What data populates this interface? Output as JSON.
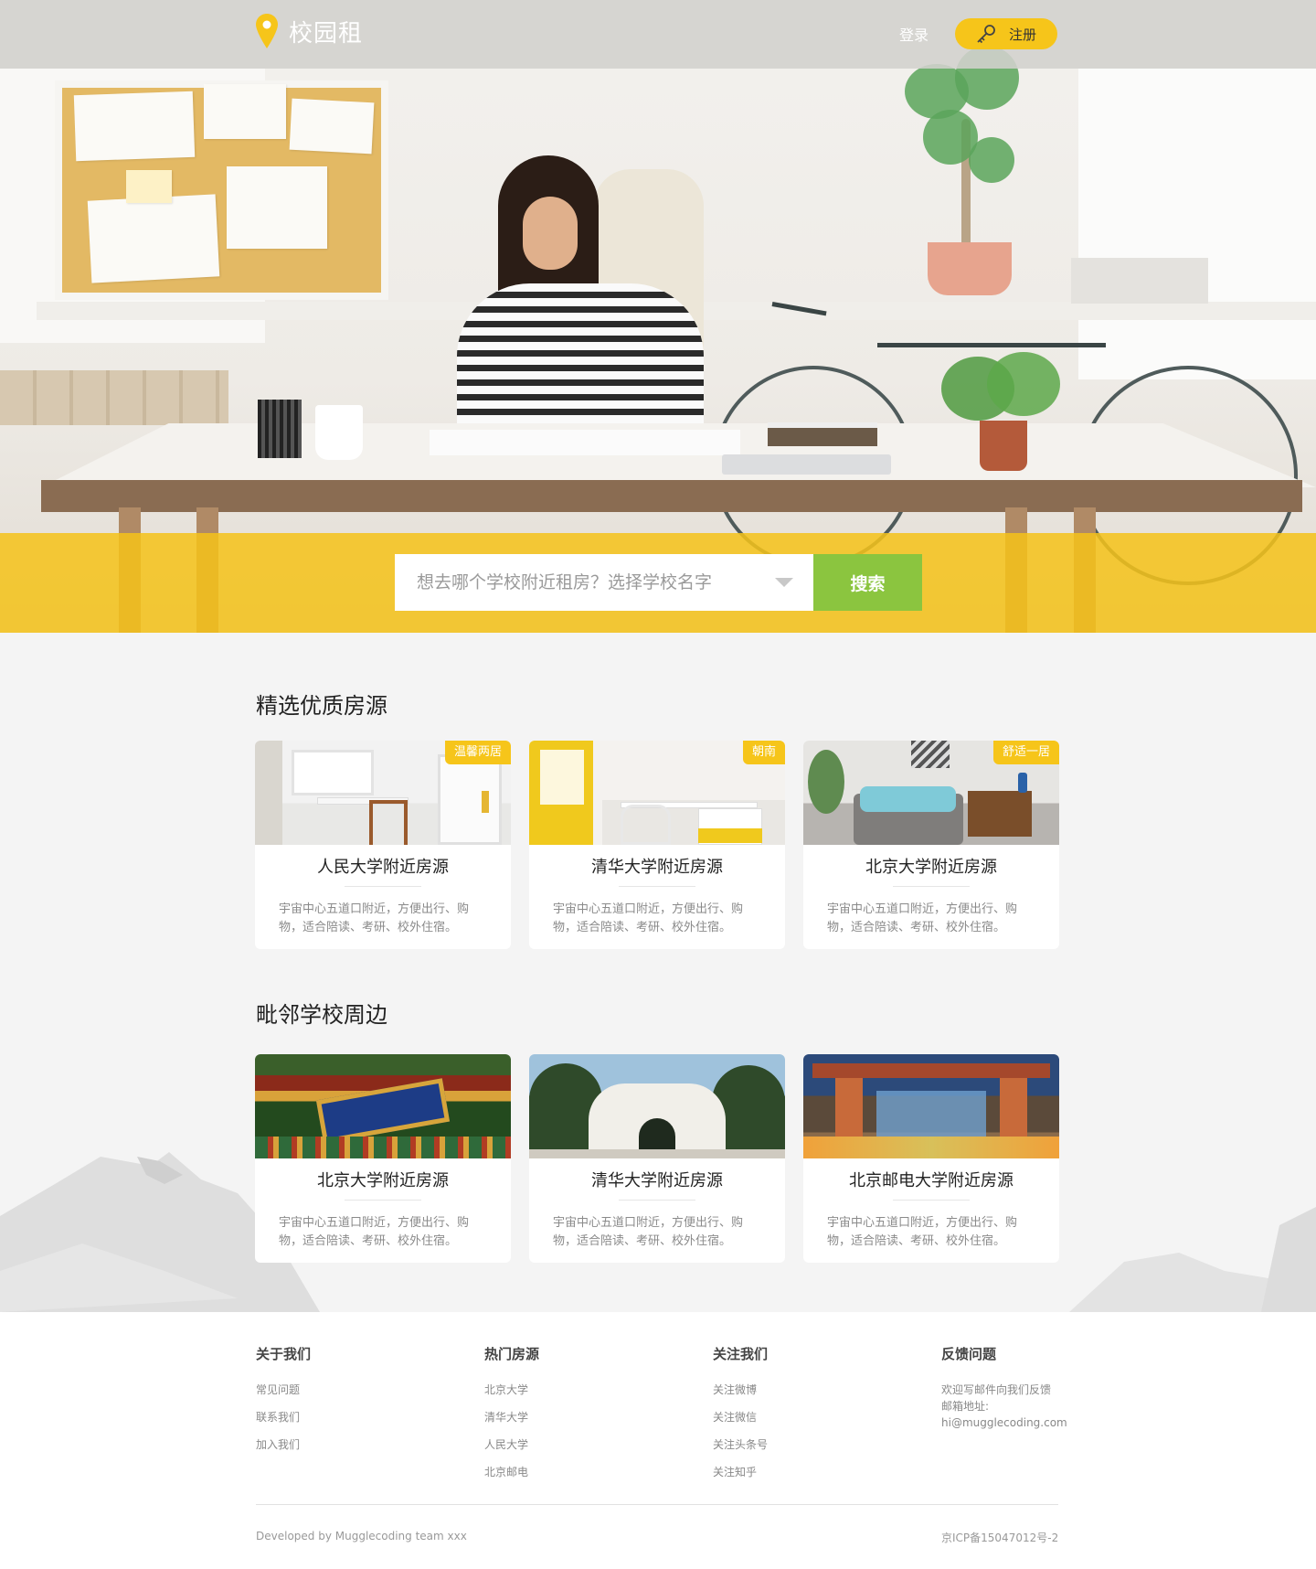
{
  "header": {
    "logo_text": "校园租",
    "login_label": "登录",
    "register_label": "注册"
  },
  "search": {
    "placeholder": "想去哪个学校附近租房？选择学校名字",
    "button_label": "搜索"
  },
  "colors": {
    "accent_yellow": "#f6c51a",
    "search_green": "#8bc53f"
  },
  "featured": {
    "title": "精选优质房源",
    "cards": [
      {
        "tag": "温馨两居",
        "title": "人民大学附近房源",
        "desc": "宇宙中心五道口附近，方便出行、购物，适合陪读、考研、校外住宿。"
      },
      {
        "tag": "朝南",
        "title": "清华大学附近房源",
        "desc": "宇宙中心五道口附近，方便出行、购物，适合陪读、考研、校外住宿。"
      },
      {
        "tag": "舒适一居",
        "title": "北京大学附近房源",
        "desc": "宇宙中心五道口附近，方便出行、购物，适合陪读、考研、校外住宿。"
      }
    ]
  },
  "nearby": {
    "title": "毗邻学校周边",
    "cards": [
      {
        "title": "北京大学附近房源",
        "desc": "宇宙中心五道口附近，方便出行、购物，适合陪读、考研、校外住宿。"
      },
      {
        "title": "清华大学附近房源",
        "desc": "宇宙中心五道口附近，方便出行、购物，适合陪读、考研、校外住宿。"
      },
      {
        "title": "北京邮电大学附近房源",
        "desc": "宇宙中心五道口附近，方便出行、购物，适合陪读、考研、校外住宿。"
      }
    ]
  },
  "footer": {
    "about": {
      "title": "关于我们",
      "links": [
        "常见问题",
        "联系我们",
        "加入我们"
      ]
    },
    "hot": {
      "title": "热门房源",
      "links": [
        "北京大学",
        "清华大学",
        "人民大学",
        "北京邮电"
      ]
    },
    "follow": {
      "title": "关注我们",
      "links": [
        "关注微博",
        "关注微信",
        "关注头条号",
        "关注知乎"
      ]
    },
    "feedback": {
      "title": "反馈问题",
      "lines": [
        "欢迎写邮件向我们反馈",
        "邮箱地址:",
        "hi@mugglecoding.com"
      ]
    },
    "credit": "Developed by Mugglecoding team xxx",
    "icp": "京ICP备15047012号-2"
  }
}
